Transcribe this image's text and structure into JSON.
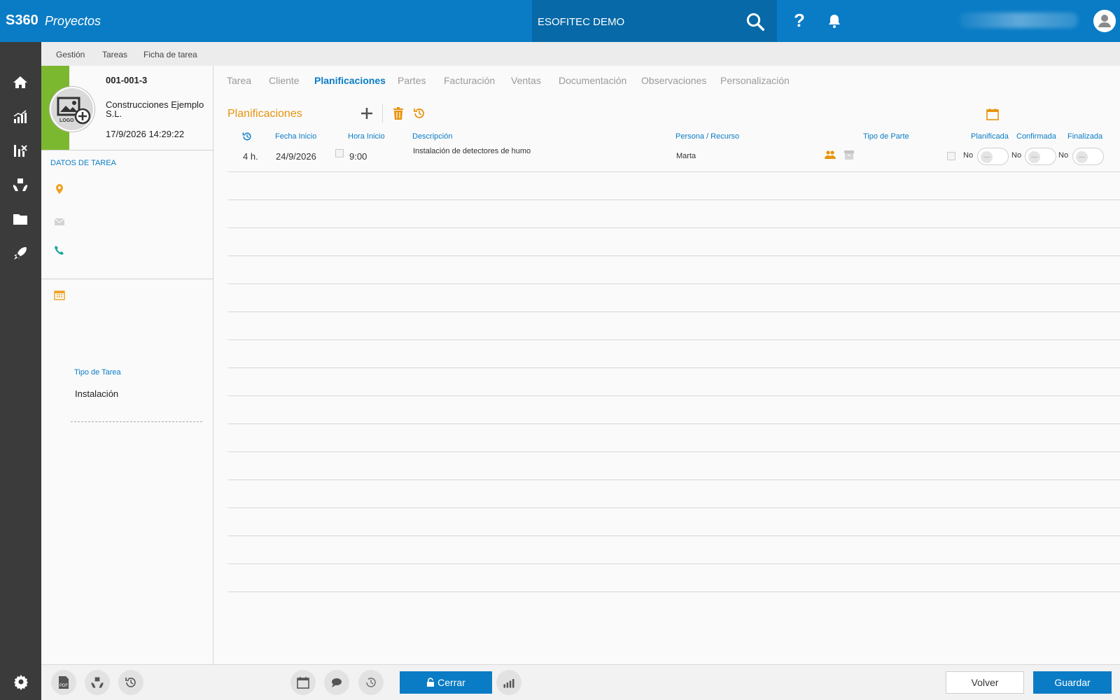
{
  "app": {
    "brand": "S360",
    "module": "Proyectos"
  },
  "header": {
    "company": "ESOFITEC DEMO"
  },
  "breadcrumb": [
    "Gestión",
    "Tareas",
    "Ficha de tarea"
  ],
  "task": {
    "code": "001-001-3",
    "client": "Construcciones Ejemplo S.L.",
    "datetime": "17/9/2026 14:29:22",
    "datos_title": "DATOS DE TAREA",
    "tipo_label": "Tipo de Tarea",
    "tipo_value": "Instalación"
  },
  "tabs": [
    "Tarea",
    "Cliente",
    "Planificaciones",
    "Partes",
    "Facturación",
    "Ventas",
    "Documentación",
    "Observaciones",
    "Personalización"
  ],
  "active_tab": "Planificaciones",
  "planificaciones": {
    "title": "Planificaciones",
    "columns": {
      "fecha": "Fecha Inicio",
      "hora": "Hora Inicio",
      "descripcion": "Descripción",
      "persona": "Persona / Recurso",
      "tipo_parte": "Tipo de Parte",
      "planificada": "Planificada",
      "confirmada": "Confirmada",
      "finalizada": "Finalizada"
    },
    "rows": [
      {
        "duracion": "4 h.",
        "fecha": "24/9/2026",
        "hora": "9:00",
        "descripcion": "Instalación de detectores de humo",
        "persona": "Marta",
        "tipo_parte": "",
        "planificada": "No",
        "confirmada": "No",
        "finalizada": "No"
      }
    ]
  },
  "footer": {
    "cerrar": "Cerrar",
    "volver": "Volver",
    "guardar": "Guardar",
    "logo_text": "LOGO",
    "pdf_text": "PDF"
  },
  "colors": {
    "primary": "#0a7cc5",
    "accent": "#e8930c",
    "sidebar": "#3b3b3b",
    "task_status": "#7cb82f"
  }
}
